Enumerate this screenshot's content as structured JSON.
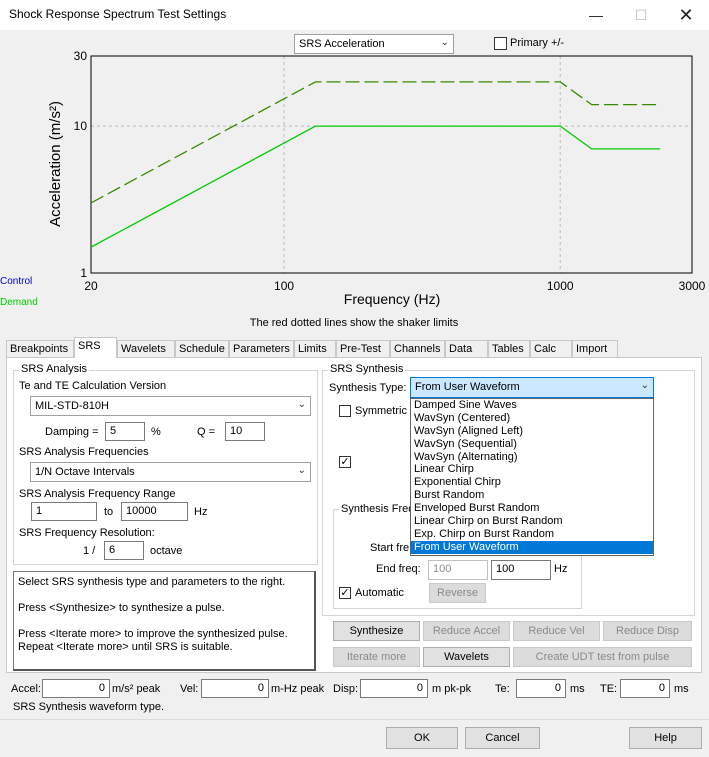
{
  "window": {
    "title": "Shock Response Spectrum Test Settings",
    "minimize_icon": "minimize-icon",
    "maximize_icon": "maximize-icon",
    "close_icon": "close-icon"
  },
  "plot_toolbar": {
    "plot_type": "SRS Acceleration",
    "primary_label": "Primary +/-",
    "primary_checked": false
  },
  "legend": {
    "control": "Control",
    "demand": "Demand",
    "control_color": "#0000cc",
    "demand_color": "#00cc00"
  },
  "chart_data": {
    "type": "line",
    "ylabel": "Acceleration (m/s²)",
    "xlabel": "Frequency (Hz)",
    "xscale": "log",
    "yscale": "log",
    "xlim": [
      20,
      3000
    ],
    "ylim": [
      1,
      30
    ],
    "xticks": [
      "20",
      "100",
      "1000",
      "3000"
    ],
    "yticks": [
      "1",
      "10",
      "30"
    ],
    "grid": true,
    "note": "The red dotted lines show the shaker limits",
    "series": [
      {
        "style": "solid",
        "color": "#00cc00",
        "x": [
          20,
          130,
          1000,
          1300,
          2300
        ],
        "y": [
          1.5,
          10,
          10,
          7,
          7
        ]
      },
      {
        "style": "dashed",
        "color": "#3a8a00",
        "x": [
          20,
          130,
          1000,
          1300,
          2300
        ],
        "y": [
          3,
          20,
          20,
          14,
          14
        ]
      }
    ]
  },
  "tabs": [
    "Breakpoints",
    "SRS",
    "Wavelets",
    "Schedule",
    "Parameters",
    "Limits",
    "Pre-Test",
    "Channels",
    "Data",
    "Tables",
    "Calc",
    "Import"
  ],
  "srs_analysis": {
    "group": "SRS Analysis",
    "te_label": "Te and TE Calculation Version",
    "te_value": "MIL-STD-810H",
    "damping_label": "Damping =",
    "damping_value": "5",
    "damping_unit": "%",
    "q_label": "Q =",
    "q_value": "10",
    "freqs_label": "SRS Analysis Frequencies",
    "freqs_value": "1/N Octave Intervals",
    "range_label": "SRS Analysis Frequency Range",
    "range_from": "1",
    "range_to_label": "to",
    "range_to": "10000",
    "range_unit": "Hz",
    "res_label": "SRS Frequency Resolution:",
    "res_prefix": "1 /",
    "res_value": "6",
    "res_unit": "octave"
  },
  "info_text": {
    "line1": "Select SRS synthesis type and parameters to the right.",
    "line2": "Press <Synthesize> to synthesize a pulse.",
    "line3": "Press <Iterate more> to improve the synthesized pulse.",
    "line4": "Repeat <Iterate more> until SRS is suitable."
  },
  "srs_synthesis": {
    "group": "SRS Synthesis",
    "type_label": "Synthesis Type:",
    "type_value": "From User Waveform",
    "options": [
      "Damped Sine Waves",
      "WavSyn (Centered)",
      "WavSyn (Aligned Left)",
      "WavSyn (Sequential)",
      "WavSyn (Alternating)",
      "Linear Chirp",
      "Exponential Chirp",
      "Burst Random",
      "Enveloped Burst Random",
      "Linear Chirp on Burst Random",
      "Exp. Chirp on Burst Random",
      "From User Waveform"
    ],
    "symmetric_label": "Symmetric P",
    "symmetric_checked": false,
    "check2_checked": true,
    "freq_group": "Synthesis Freq",
    "start_label": "Start fre",
    "end_label": "End freq:",
    "end_value_disabled": "100",
    "end_value": "100",
    "end_unit": "Hz",
    "automatic_label": "Automatic",
    "automatic_checked": true,
    "reverse_label": "Reverse"
  },
  "buttons": {
    "synthesize": "Synthesize",
    "reduce_accel": "Reduce Accel",
    "reduce_vel": "Reduce Vel",
    "reduce_disp": "Reduce Disp",
    "iterate_more": "Iterate more",
    "wavelets": "Wavelets",
    "create_udt": "Create UDT test from pulse"
  },
  "readouts": {
    "accel_label": "Accel:",
    "accel_value": "0",
    "accel_unit": "m/s² peak",
    "vel_label": "Vel:",
    "vel_value": "0",
    "vel_unit": "m-Hz peak",
    "disp_label": "Disp:",
    "disp_value": "0",
    "disp_unit": "m pk-pk",
    "te_label": "Te:",
    "te_value": "0",
    "te_unit": "ms",
    "tE_label": "TE:",
    "tE_value": "0",
    "tE_unit": "ms"
  },
  "status": "SRS Synthesis waveform type.",
  "footer": {
    "ok": "OK",
    "cancel": "Cancel",
    "help": "Help"
  }
}
